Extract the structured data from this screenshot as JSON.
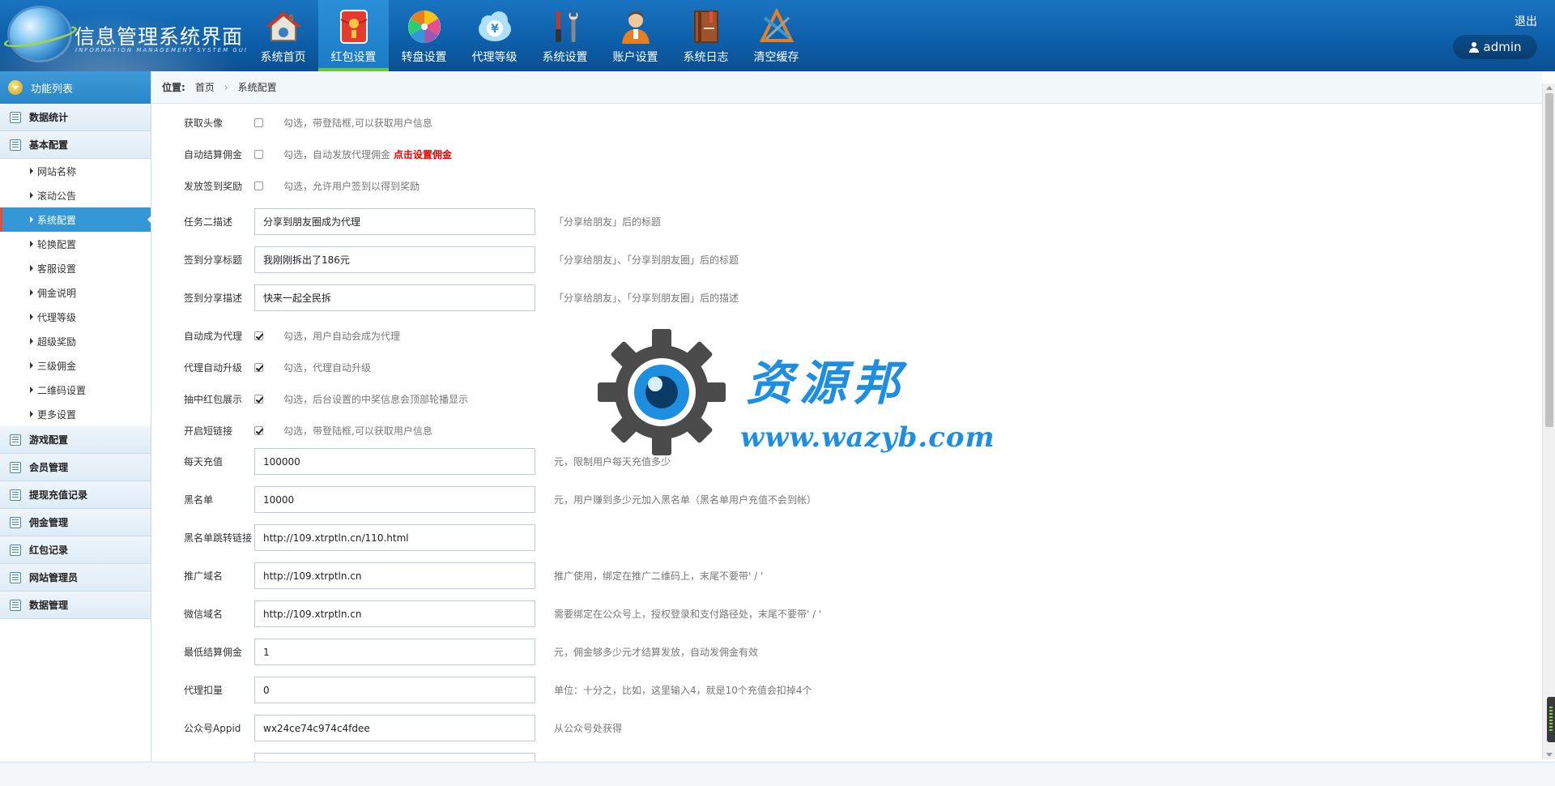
{
  "header": {
    "title": "信息管理系统界面",
    "subtitle": "INFORMATION MANAGEMENT SYSTEM GUI",
    "logout": "退出",
    "username": "admin"
  },
  "nav": [
    {
      "label": "系统首页",
      "icon": "home-icon"
    },
    {
      "label": "红包设置",
      "icon": "red-envelope-icon",
      "active": true
    },
    {
      "label": "转盘设置",
      "icon": "wheel-icon"
    },
    {
      "label": "代理等级",
      "icon": "yen-cloud-icon"
    },
    {
      "label": "系统设置",
      "icon": "tools-icon"
    },
    {
      "label": "账户设置",
      "icon": "user-account-icon"
    },
    {
      "label": "系统日志",
      "icon": "log-book-icon"
    },
    {
      "label": "清空缓存",
      "icon": "clear-cache-icon"
    }
  ],
  "sidebar": {
    "title": "功能列表",
    "groups": [
      {
        "label": "数据统计"
      },
      {
        "label": "基本配置"
      },
      {
        "label": "游戏配置"
      },
      {
        "label": "会员管理"
      },
      {
        "label": "提现充值记录"
      },
      {
        "label": "佣金管理"
      },
      {
        "label": "红包记录"
      },
      {
        "label": "网站管理员"
      },
      {
        "label": "数据管理"
      }
    ],
    "sub_items": [
      {
        "label": "网站名称"
      },
      {
        "label": "滚动公告"
      },
      {
        "label": "系统配置",
        "active": true
      },
      {
        "label": "轮换配置"
      },
      {
        "label": "客服设置"
      },
      {
        "label": "佣金说明"
      },
      {
        "label": "代理等级"
      },
      {
        "label": "超级奖励"
      },
      {
        "label": "三级佣金"
      },
      {
        "label": "二维码设置"
      },
      {
        "label": "更多设置"
      }
    ]
  },
  "breadcrumb": {
    "label": "位置:",
    "home": "首页",
    "sep": "›",
    "current": "系统配置"
  },
  "form": {
    "checkboxes": [
      {
        "label": "获取头像",
        "checked": false,
        "tip": "勾选，带登陆框,可以获取用户信息"
      },
      {
        "label": "自动结算佣金",
        "checked": false,
        "tip": "勾选，自动发放代理佣金",
        "link": "点击设置佣金"
      },
      {
        "label": "发放签到奖励",
        "checked": false,
        "tip": "勾选，允许用户签到以得到奖励"
      }
    ],
    "text_fields_a": [
      {
        "label": "任务二描述",
        "value": "分享到朋友圈成为代理",
        "hint": "「分享给朋友」后的标题"
      },
      {
        "label": "签到分享标题",
        "value": "我刚刚拆出了186元",
        "hint": "「分享给朋友」、「分享到朋友圈」后的标题"
      },
      {
        "label": "签到分享描述",
        "value": "快来一起全民拆",
        "hint": "「分享给朋友」、「分享到朋友圈」后的描述"
      }
    ],
    "checkboxes_b": [
      {
        "label": "自动成为代理",
        "checked": true,
        "tip": "勾选，用户自动会成为代理"
      },
      {
        "label": "代理自动升级",
        "checked": true,
        "tip": "勾选，代理自动升级"
      },
      {
        "label": "抽中红包展示",
        "checked": true,
        "tip": "勾选，后台设置的中奖信息会顶部轮播显示"
      },
      {
        "label": "开启短链接",
        "checked": true,
        "tip": "勾选，带登陆框,可以获取用户信息"
      }
    ],
    "text_fields_b": [
      {
        "label": "每天充值",
        "value": "100000",
        "hint": "元，限制用户每天充值多少"
      },
      {
        "label": "黑名单",
        "value": "10000",
        "hint": "元，用户赚到多少元加入黑名单（黑名单用户充值不会到帐）"
      },
      {
        "label": "黑名单跳转链接",
        "value": "http://109.xtrptln.cn/110.html",
        "hint": ""
      },
      {
        "label": "推广域名",
        "value": "http://109.xtrptln.cn",
        "hint": "推广使用，绑定在推广二维码上，末尾不要带' / '"
      },
      {
        "label": "微信域名",
        "value": "http://109.xtrptln.cn",
        "hint": "需要绑定在公众号上，授权登录和支付路径处，末尾不要带' / '"
      },
      {
        "label": "最低结算佣金",
        "value": "1",
        "hint": "元，佣金够多少元才结算发放，自动发佣金有效"
      },
      {
        "label": "代理扣量",
        "value": "0",
        "hint": "单位：十分之，比如，这里输入4，就是10个充值会扣掉4个"
      },
      {
        "label": "公众号Appid",
        "value": "wx24ce74c974c4fdee",
        "hint": "从公众号处获得"
      }
    ]
  },
  "watermark": {
    "text": "资源邦",
    "url": "www.wazyb.com"
  },
  "colors": {
    "header": "#0d5ea8",
    "active_nav_underline": "#6bc43a",
    "sidebar_active": "#3497d6",
    "link_red": "#e00000",
    "watermark_blue": "#1e8fe0"
  }
}
